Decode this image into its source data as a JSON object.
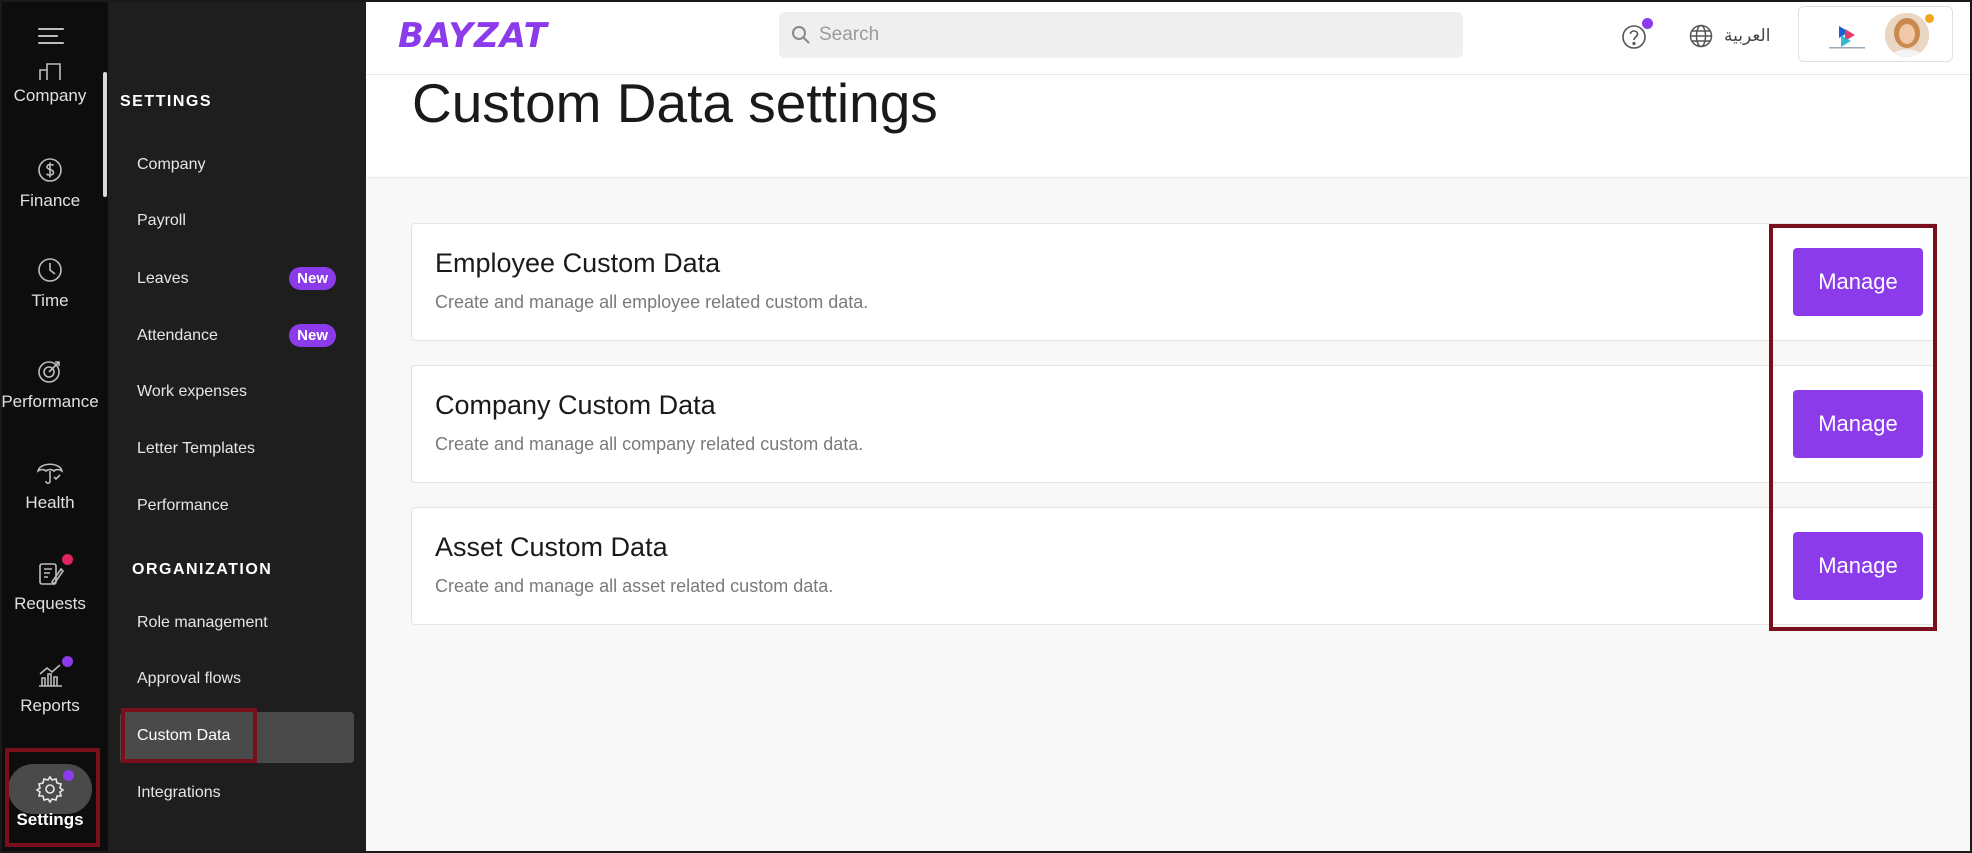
{
  "rail": {
    "items": [
      {
        "label": "Company",
        "icon": "building-icon"
      },
      {
        "label": "Finance",
        "icon": "dollar-icon"
      },
      {
        "label": "Time",
        "icon": "clock-icon"
      },
      {
        "label": "Performance",
        "icon": "target-icon"
      },
      {
        "label": "Health",
        "icon": "umbrella-icon"
      },
      {
        "label": "Requests",
        "icon": "request-icon"
      },
      {
        "label": "Reports",
        "icon": "reports-icon"
      },
      {
        "label": "Settings",
        "icon": "gear-icon"
      }
    ]
  },
  "panel": {
    "settings_heading": "SETTINGS",
    "settings_items": [
      {
        "label": "Company"
      },
      {
        "label": "Payroll"
      },
      {
        "label": "Leaves",
        "badge": "New"
      },
      {
        "label": "Attendance",
        "badge": "New"
      },
      {
        "label": "Work expenses"
      },
      {
        "label": "Letter Templates"
      },
      {
        "label": "Performance"
      }
    ],
    "organization_heading": "ORGANIZATION",
    "organization_items": [
      {
        "label": "Role management"
      },
      {
        "label": "Approval flows"
      },
      {
        "label": "Custom Data"
      },
      {
        "label": "Integrations"
      }
    ]
  },
  "header": {
    "logo": "BAYZAT",
    "search_placeholder": "Search",
    "language": "العربية"
  },
  "main": {
    "title": "Custom Data settings",
    "cards": [
      {
        "title": "Employee Custom Data",
        "description": "Create and manage all employee related custom data.",
        "button": "Manage"
      },
      {
        "title": "Company Custom Data",
        "description": "Create and manage all company related custom data.",
        "button": "Manage"
      },
      {
        "title": "Asset Custom Data",
        "description": "Create and manage all asset related custom data.",
        "button": "Manage"
      }
    ]
  },
  "colors": {
    "accent": "#8b3bea",
    "highlight": "#7a0f1c",
    "rail_bg": "#0d0d0d",
    "panel_bg": "#1e1e1e"
  }
}
